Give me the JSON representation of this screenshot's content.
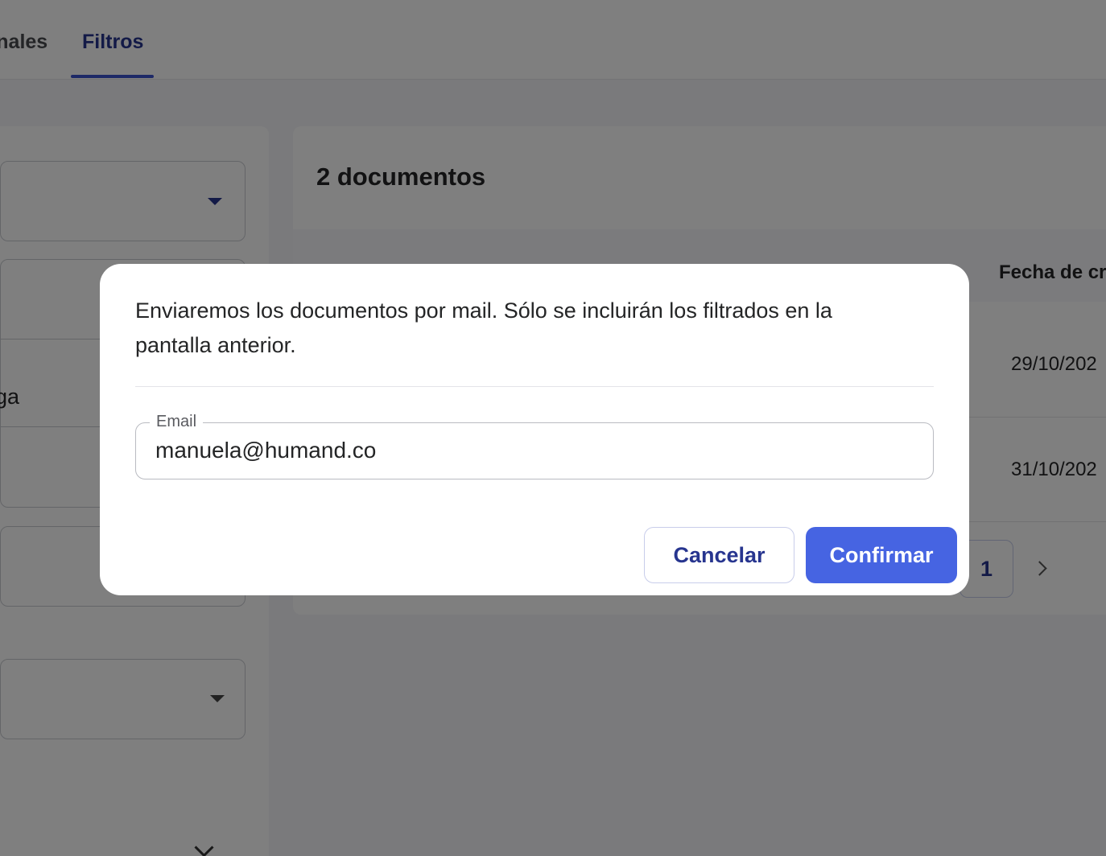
{
  "tabs": [
    {
      "label": "onales"
    },
    {
      "label": "Filtros"
    }
  ],
  "filters": {
    "partial_text": "ga"
  },
  "documents": {
    "title": "2 documentos",
    "column_header": "Fecha de cr",
    "rows": [
      {
        "date": "29/10/202"
      },
      {
        "date": "31/10/202"
      }
    ],
    "pagination": {
      "current_page": "1"
    }
  },
  "modal": {
    "message": "Enviaremos los documentos por mail. Sólo se incluirán los filtrados en la pantalla anterior.",
    "email_label": "Email",
    "email_value": "manuela@humand.co",
    "cancel_label": "Cancelar",
    "confirm_label": "Confirmar"
  },
  "colors": {
    "primary": "#4664e2",
    "brand_dark": "#27358f",
    "overlay": "rgba(0,0,0,0.5)"
  }
}
